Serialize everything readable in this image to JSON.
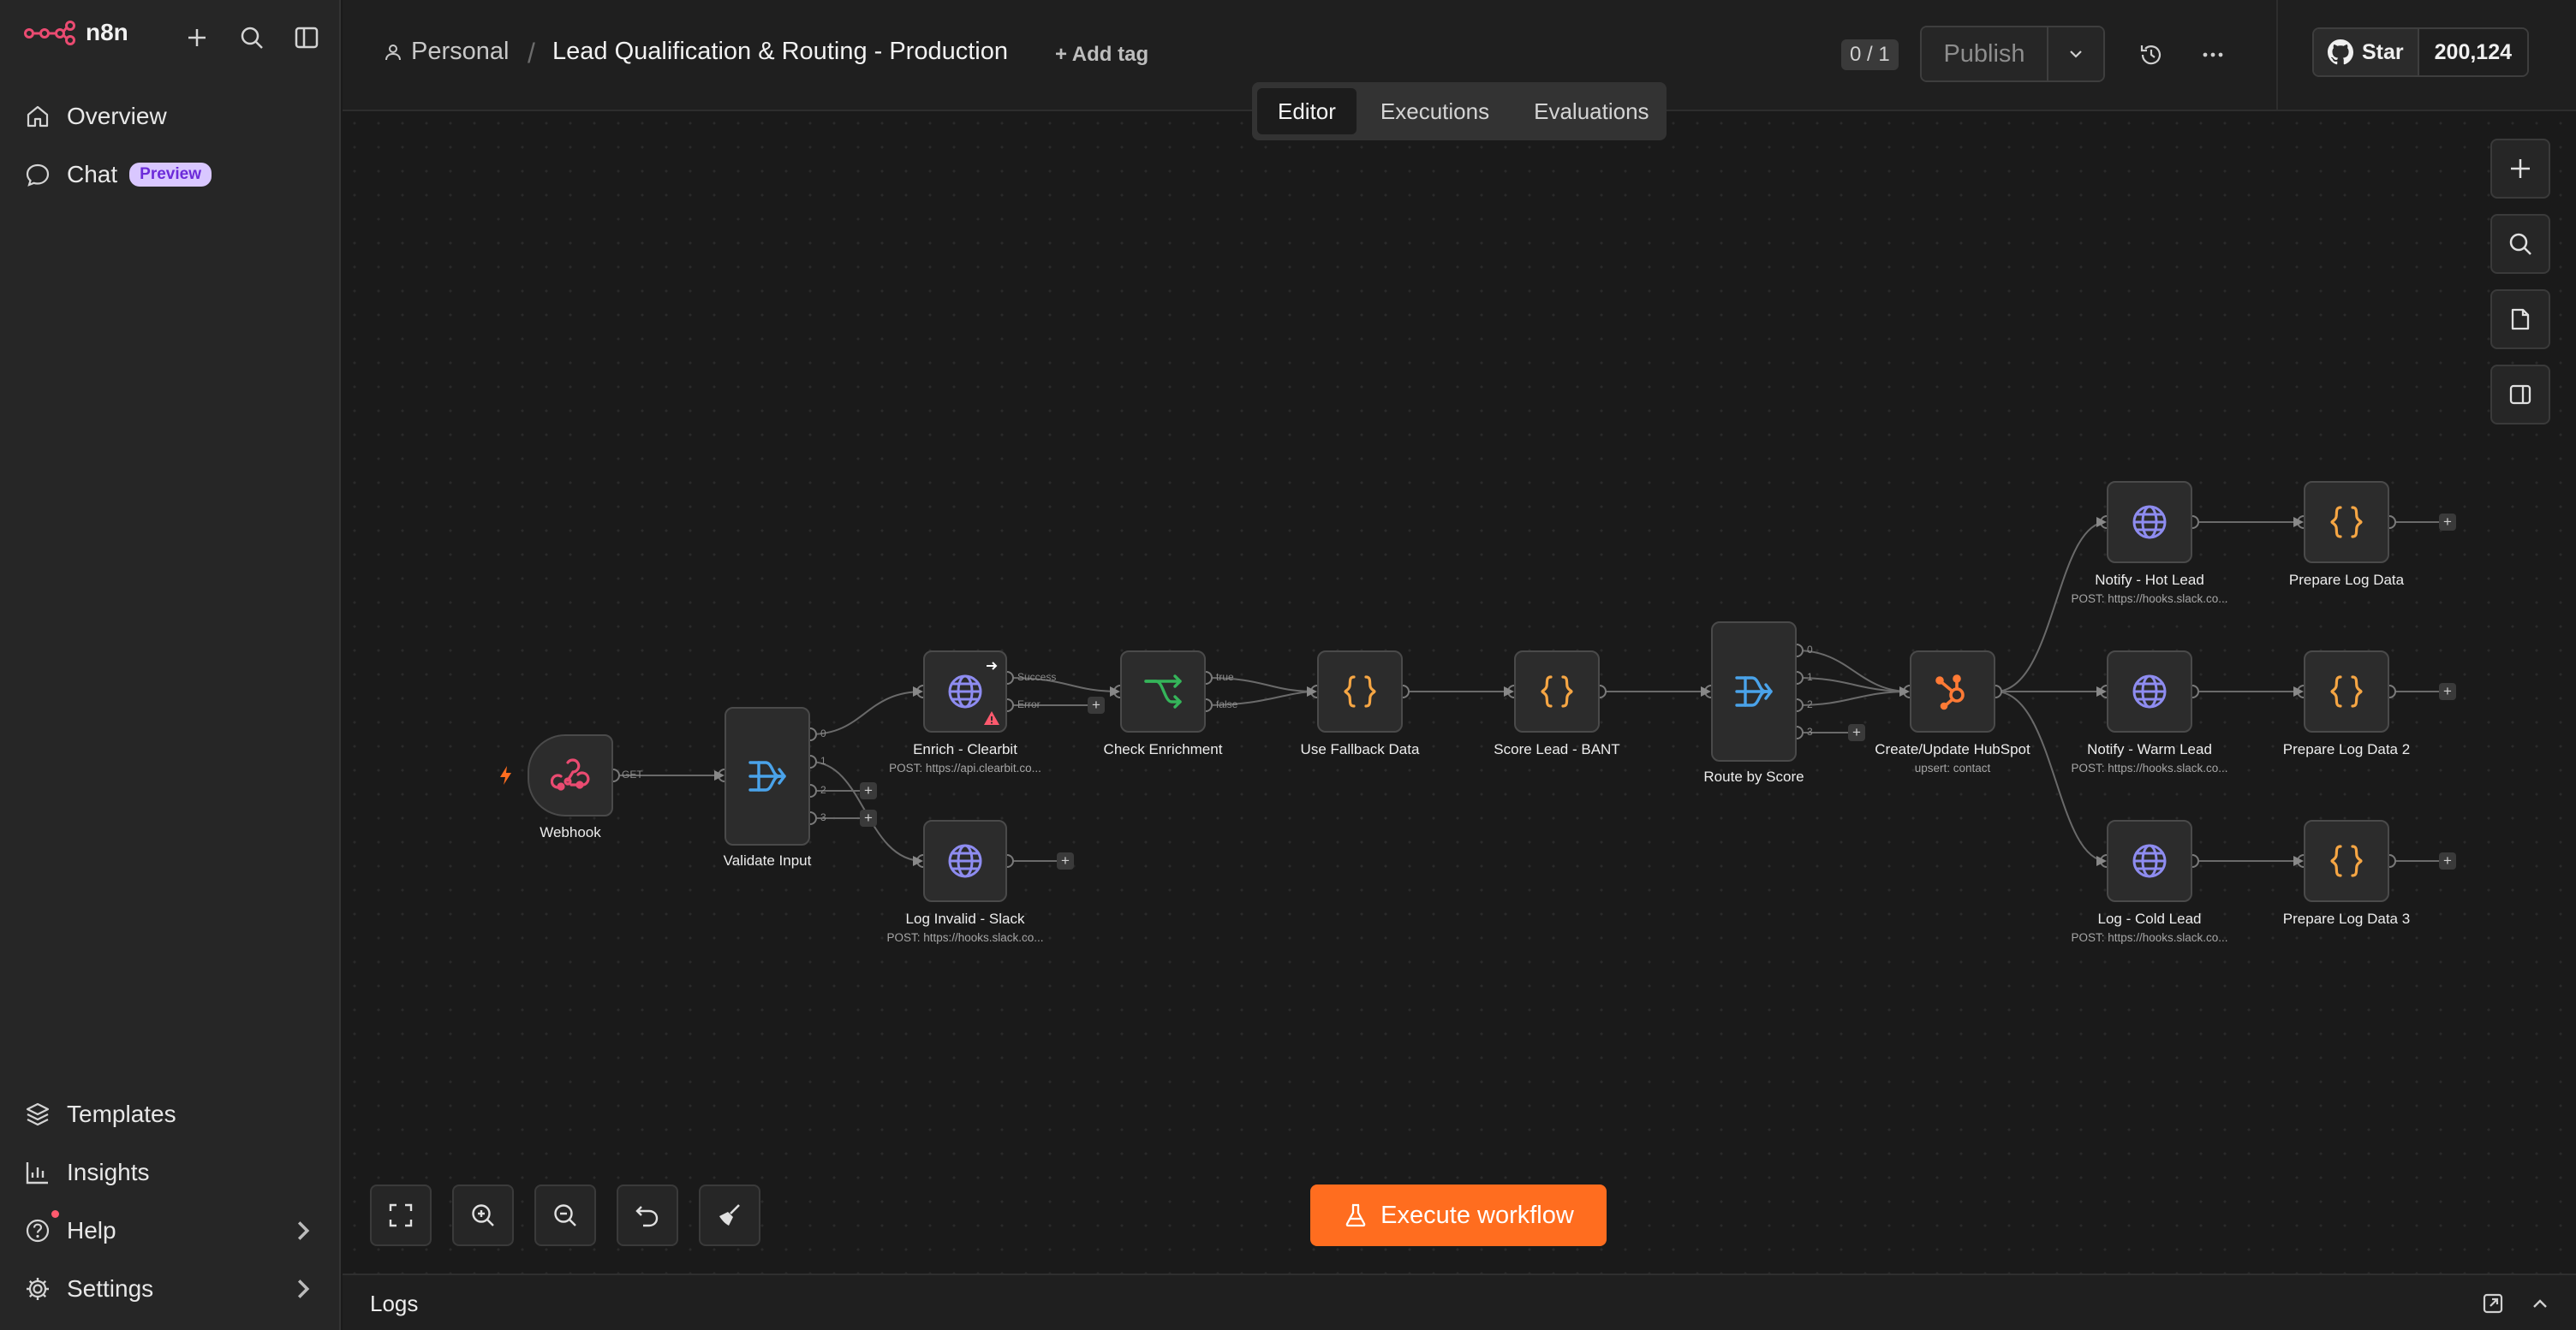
{
  "app": {
    "name": "n8n"
  },
  "sidebar": {
    "nav_top": [
      {
        "label": "Overview",
        "icon": "home-icon"
      },
      {
        "label": "Chat",
        "icon": "chat-icon",
        "badge": "Preview"
      }
    ],
    "nav_bottom": [
      {
        "label": "Templates",
        "icon": "templates-icon"
      },
      {
        "label": "Insights",
        "icon": "insights-icon"
      },
      {
        "label": "Help",
        "icon": "help-icon"
      },
      {
        "label": "Settings",
        "icon": "settings-icon"
      }
    ]
  },
  "header": {
    "project": "Personal",
    "separator": "/",
    "workflow_name": "Lead Qualification & Routing - Production",
    "add_tag": "+ Add tag",
    "version": "0 / 1",
    "publish": "Publish",
    "github_star": "Star",
    "github_count": "200,124"
  },
  "tabs": [
    {
      "label": "Editor",
      "active": true
    },
    {
      "label": "Executions",
      "active": false
    },
    {
      "label": "Evaluations",
      "active": false
    }
  ],
  "workflow": {
    "nodes": [
      {
        "id": "webhook",
        "label": "Webhook",
        "subtitle": "",
        "icon": "webhook-icon"
      },
      {
        "id": "validate",
        "label": "Validate Input",
        "subtitle": "",
        "icon": "switch-icon"
      },
      {
        "id": "enrich",
        "label": "Enrich - Clearbit",
        "subtitle": "POST: https://api.clearbit.co...",
        "icon": "globe-icon"
      },
      {
        "id": "loginvalid",
        "label": "Log Invalid - Slack",
        "subtitle": "POST: https://hooks.slack.co...",
        "icon": "globe-icon"
      },
      {
        "id": "checkenrich",
        "label": "Check Enrichment",
        "subtitle": "",
        "icon": "if-icon"
      },
      {
        "id": "fallback",
        "label": "Use Fallback Data",
        "subtitle": "",
        "icon": "code-icon"
      },
      {
        "id": "score",
        "label": "Score Lead - BANT",
        "subtitle": "",
        "icon": "code-icon"
      },
      {
        "id": "route",
        "label": "Route by Score",
        "subtitle": "",
        "icon": "switch-icon"
      },
      {
        "id": "hubspot",
        "label": "Create/Update HubSpot",
        "subtitle": "upsert: contact",
        "icon": "hubspot-icon"
      },
      {
        "id": "hot",
        "label": "Notify - Hot Lead",
        "subtitle": "POST: https://hooks.slack.co...",
        "icon": "globe-icon"
      },
      {
        "id": "warm",
        "label": "Notify - Warm Lead",
        "subtitle": "POST: https://hooks.slack.co...",
        "icon": "globe-icon"
      },
      {
        "id": "cold",
        "label": "Log - Cold Lead",
        "subtitle": "POST: https://hooks.slack.co...",
        "icon": "globe-icon"
      },
      {
        "id": "plog1",
        "label": "Prepare Log Data",
        "subtitle": "",
        "icon": "code-icon"
      },
      {
        "id": "plog2",
        "label": "Prepare Log Data 2",
        "subtitle": "",
        "icon": "code-icon"
      },
      {
        "id": "plog3",
        "label": "Prepare Log Data 3",
        "subtitle": "",
        "icon": "code-icon"
      }
    ],
    "port_labels": {
      "webhook_out": "GET",
      "enrich_success": "Success",
      "enrich_error": "Error",
      "check_true": "true",
      "check_false": "false",
      "validate_outputs": [
        "0",
        "1",
        "2",
        "3"
      ],
      "route_outputs": [
        "0",
        "1",
        "2",
        "3"
      ]
    }
  },
  "canvas_controls": {
    "execute": "Execute workflow"
  },
  "logs": {
    "title": "Logs"
  },
  "colors": {
    "accent": "#ff6d1f",
    "brand": "#ea4b71",
    "globe": "#8e8cf0",
    "switch": "#4aa3ea",
    "code": "#f6a644",
    "if": "#35b55a",
    "hubspot": "#ff7a35"
  }
}
